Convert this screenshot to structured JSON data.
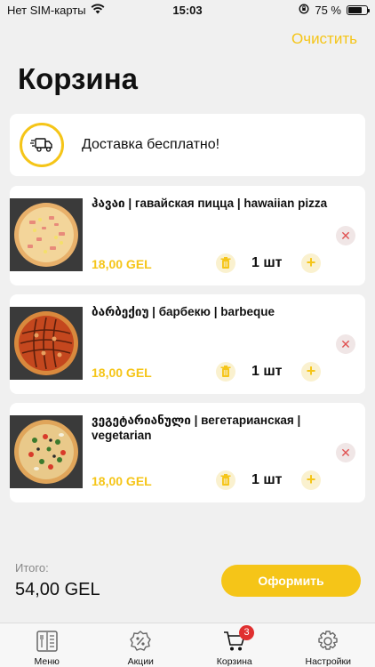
{
  "status_bar": {
    "carrier": "Нет SIM-карты",
    "time": "15:03",
    "battery": "75 %",
    "battery_level": 0.75
  },
  "header": {
    "title": "Корзина",
    "clear_label": "Очистить"
  },
  "delivery": {
    "text": "Доставка бесплатно!",
    "icon": "truck-icon"
  },
  "items": [
    {
      "name": "ჰავაი | гавайская пицца | hawaiian pizza",
      "price": "18,00 GEL",
      "quantity": "1 шт",
      "pizza": "hawaiian"
    },
    {
      "name": "ბარბექიუ | барбекю | barbeque",
      "price": "18,00 GEL",
      "quantity": "1 шт",
      "pizza": "barbeque"
    },
    {
      "name": "ვეგეტარიანული | вегетарианская | vegetarian",
      "price": "18,00 GEL",
      "quantity": "1 шт",
      "pizza": "vegetarian"
    }
  ],
  "summary": {
    "total_label": "Итого:",
    "total_value": "54,00 GEL",
    "checkout_label": "Оформить"
  },
  "tabs": [
    {
      "label": "Меню",
      "icon": "menu-book-icon"
    },
    {
      "label": "Акции",
      "icon": "discount-badge-icon"
    },
    {
      "label": "Корзина",
      "icon": "cart-icon",
      "badge": "3"
    },
    {
      "label": "Настройки",
      "icon": "settings-gear-icon"
    }
  ],
  "colors": {
    "accent": "#f5c518",
    "background": "#f0f0f0",
    "remove": "#e05050",
    "badge": "#e03030"
  }
}
